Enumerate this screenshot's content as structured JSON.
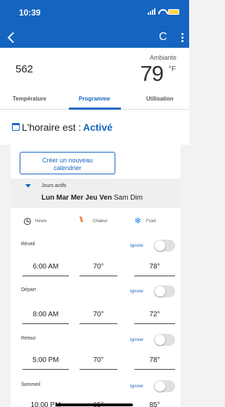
{
  "status_bar": {
    "time": "10:39"
  },
  "nav": {
    "refresh_glyph": "C",
    "back_icon": "chevron-left-icon",
    "more_icon": "more-vertical-icon"
  },
  "device": {
    "name": "562",
    "ambient_label": "Ambiante",
    "ambient_temp": "79",
    "ambient_unit": "°F"
  },
  "tabs": [
    {
      "label": "Température"
    },
    {
      "label": "Programme",
      "active": true
    },
    {
      "label": "Utilisation"
    }
  ],
  "schedule": {
    "status_label": "L'horaire est :",
    "status_value": "Activé"
  },
  "create_button": {
    "line1": "Créer un nouveau",
    "line2": "calendrier"
  },
  "days": {
    "label": "Jours actifs",
    "items": [
      {
        "label": "Lun",
        "active": true
      },
      {
        "label": "Mar",
        "active": true
      },
      {
        "label": "Mer",
        "active": true
      },
      {
        "label": "Jeu",
        "active": true
      },
      {
        "label": "Ven",
        "active": true
      },
      {
        "label": "Sam",
        "active": false
      },
      {
        "label": "Dim",
        "active": false
      }
    ]
  },
  "legend": {
    "hour": "Heure",
    "heat": "Chaleur",
    "cool": "Froid",
    "heat_color": "#e8702a",
    "cool_color": "#1e88e5"
  },
  "periods": [
    {
      "name": "Réveil",
      "ignore_label": "Ignorer",
      "ignored": false,
      "time": "6:00 AM",
      "heat": "70°",
      "cool": "78°"
    },
    {
      "name": "Départ",
      "ignore_label": "Ignorer",
      "ignored": false,
      "time": "8:00 AM",
      "heat": "70°",
      "cool": "72°"
    },
    {
      "name": "Retour",
      "ignore_label": "Ignorer",
      "ignored": false,
      "time": "5:00 PM",
      "heat": "70°",
      "cool": "78°"
    },
    {
      "name": "Sommeil",
      "ignore_label": "Ignorer",
      "ignored": false,
      "time": "10:00 PM",
      "heat": "65°",
      "cool": "85°"
    }
  ],
  "colors": {
    "brand": "#1565c0",
    "background": "#f2f2f2"
  }
}
